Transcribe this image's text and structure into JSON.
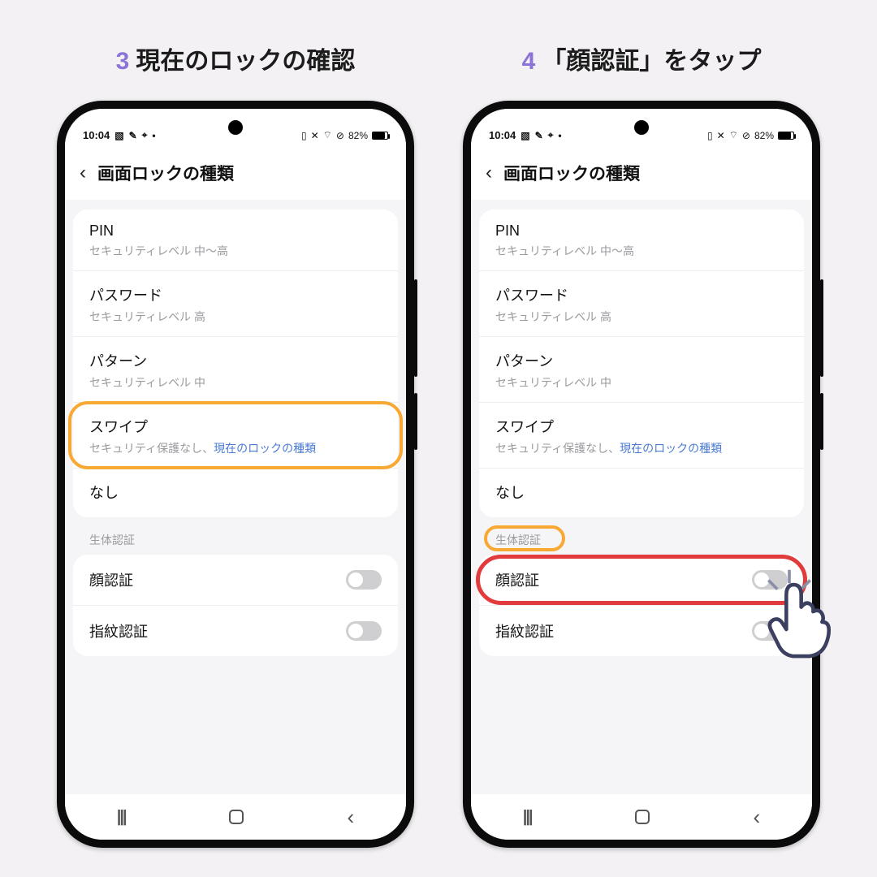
{
  "step3": {
    "num": "3",
    "title": "現在のロックの確認"
  },
  "step4": {
    "num": "4",
    "title": "「顔認証」をタップ"
  },
  "status": {
    "time": "10:04",
    "battery_text": "82%",
    "icons_left": [
      "image-icon",
      "chat-icon",
      "sms-icon"
    ],
    "icons_right": [
      "card-icon",
      "mute-icon",
      "wifi-icon",
      "block-icon"
    ]
  },
  "header": {
    "title": "画面ロックの種類"
  },
  "lock_options": [
    {
      "label": "PIN",
      "sub": "セキュリティレベル 中〜高"
    },
    {
      "label": "パスワード",
      "sub": "セキュリティレベル 高"
    },
    {
      "label": "パターン",
      "sub": "セキュリティレベル 中"
    },
    {
      "label": "スワイプ",
      "sub_prefix": "セキュリティ保護なし、",
      "sub_link": "現在のロックの種類"
    },
    {
      "label": "なし"
    }
  ],
  "biometrics": {
    "section_label": "生体認証",
    "items": [
      {
        "label": "顔認証",
        "on": false
      },
      {
        "label": "指紋認証",
        "on": false
      }
    ]
  },
  "nav": {
    "recents": "|||",
    "back": "‹"
  },
  "colors": {
    "accent_purple": "#8b74d6",
    "callout_orange": "#f7a934",
    "callout_red": "#e23b3b",
    "link_blue": "#4a7bd4"
  }
}
